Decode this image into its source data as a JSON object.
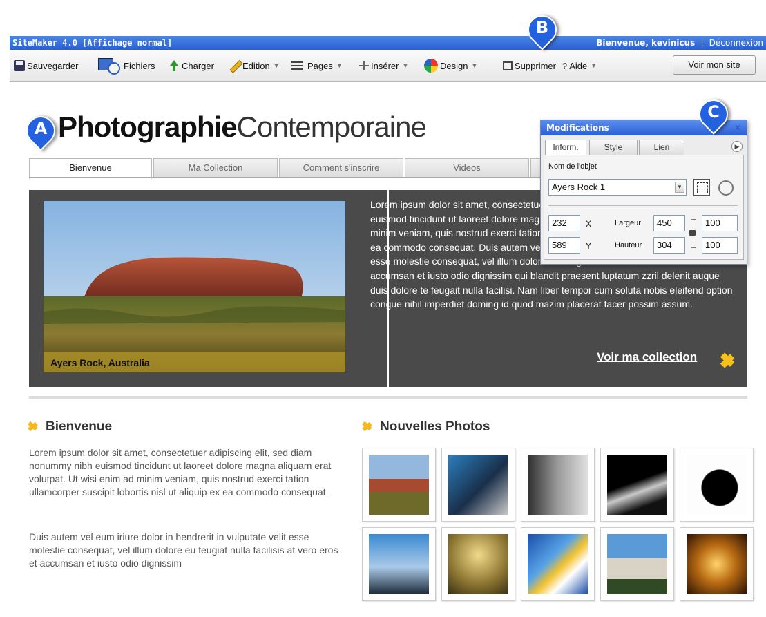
{
  "titlebar": {
    "app": "SiteMaker 4.0  [Affichage normal]",
    "welcome": "Bienvenue, kevinicus",
    "separator": "|",
    "logout": "Déconnexion"
  },
  "toolbar": {
    "save": "Sauvegarder",
    "files": "Fichiers",
    "upload": "Charger",
    "edit": "Edition",
    "pages": "Pages",
    "insert": "Insérer",
    "design": "Design",
    "delete": "Supprimer",
    "help_mark": "?",
    "help": "Aide",
    "view_site": "Voir mon site"
  },
  "site": {
    "title_bold": "Photographie",
    "title_light": "Contemporaine",
    "tabs": [
      "Bienvenue",
      "Ma Collection",
      "Comment s'inscrire",
      "Videos"
    ]
  },
  "hero": {
    "caption": "Ayers Rock, Australia",
    "text": "Lorem ipsum dolor sit amet, consectetuer adipiscing elit, sed diam nonummy nibh euismod tincidunt ut laoreet dolore magna aliquam erat volutpat. Ut wisi enim ad minim veniam, quis nostrud exerci tation ullamcorper suscipit lobortis nisl ut aliquip ex ea commodo consequat. Duis autem vel eum iriure dolor in hendrerit in vulputate velit esse molestie consequat, vel illum dolore eu feugiat nulla facilisis at vero eros et accumsan et iusto odio dignissim qui blandit praesent luptatum zzril delenit augue duis dolore te feugait nulla facilisi. Nam liber tempor cum soluta nobis eleifend option congue nihil imperdiet doming id quod mazim placerat facer possim assum.",
    "link": "Voir ma collection"
  },
  "bienvenue": {
    "heading": "Bienvenue",
    "para1": "Lorem ipsum dolor sit amet, consectetuer adipiscing elit, sed diam nonummy nibh euismod tincidunt ut laoreet dolore magna aliquam erat volutpat. Ut wisi enim ad minim veniam, quis nostrud exerci tation ullamcorper suscipit lobortis nisl ut aliquip ex ea commodo consequat.",
    "para2": "Duis autem vel eum iriure dolor in hendrerit in vulputate velit esse molestie consequat, vel illum dolore eu feugiat nulla facilisis at vero eros et accumsan et iusto odio dignissim"
  },
  "photos": {
    "heading": "Nouvelles Photos"
  },
  "panel": {
    "title": "Modifications",
    "close": "✕",
    "tabs": [
      "Inform.",
      "Style",
      "Lien"
    ],
    "object_label": "Nom de l'objet",
    "object_name": "Ayers Rock 1",
    "x": "232",
    "y": "589",
    "x_label": "X",
    "y_label": "Y",
    "width_label": "Largeur",
    "height_label": "Hauteur",
    "width": "450",
    "height": "304",
    "scale_w": "100",
    "scale_h": "100"
  },
  "callouts": [
    "A",
    "B",
    "C"
  ],
  "colors": {
    "brand_blue": "#2361df",
    "accent_yellow": "#f6c21a",
    "hero_bg": "#4a4a4a"
  }
}
